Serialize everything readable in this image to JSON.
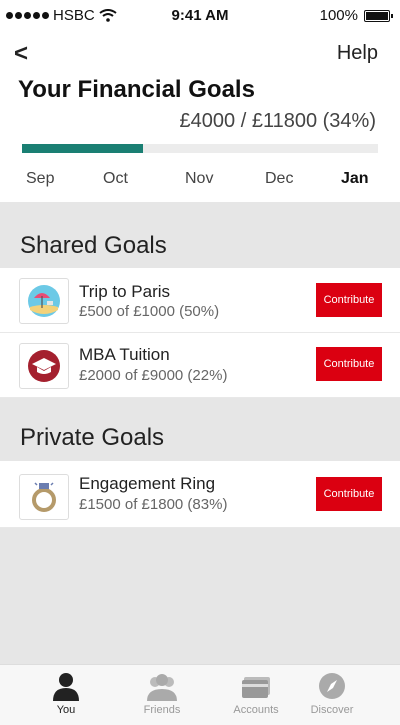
{
  "status_bar": {
    "carrier": "HSBC",
    "time": "9:41 AM",
    "battery": "100%"
  },
  "header": {
    "back": "<",
    "help": "Help",
    "title": "Your Financial Goals",
    "summary": "£4000 / £11800 (34%)",
    "progress": 0.34,
    "months": [
      "Sep",
      "Oct",
      "Nov",
      "Dec",
      "Jan"
    ],
    "active_month": "Jan"
  },
  "shared": {
    "title": "Shared Goals",
    "goals": [
      {
        "name": "Trip to Paris",
        "amount": "£500 of £1000 (50%)",
        "button": "Contribute",
        "icon": "beach-umbrella-icon"
      },
      {
        "name": "MBA Tuition",
        "amount": "£2000 of £9000 (22%)",
        "button": "Contribute",
        "icon": "graduation-cap-icon"
      }
    ]
  },
  "private": {
    "title": "Private Goals",
    "goals": [
      {
        "name": "Engagement Ring",
        "amount": "£1500 of £1800 (83%)",
        "button": "Contribute",
        "icon": "ring-icon"
      }
    ]
  },
  "tabs": [
    {
      "label": "You",
      "icon": "person-icon",
      "active": true
    },
    {
      "label": "Friends",
      "icon": "friends-icon",
      "active": false
    },
    {
      "label": "Accounts",
      "icon": "card-icon",
      "active": false
    },
    {
      "label": "Discover",
      "icon": "compass-icon",
      "active": false
    }
  ],
  "colors": {
    "accent": "#db0011",
    "progress": "#1a7f73"
  }
}
